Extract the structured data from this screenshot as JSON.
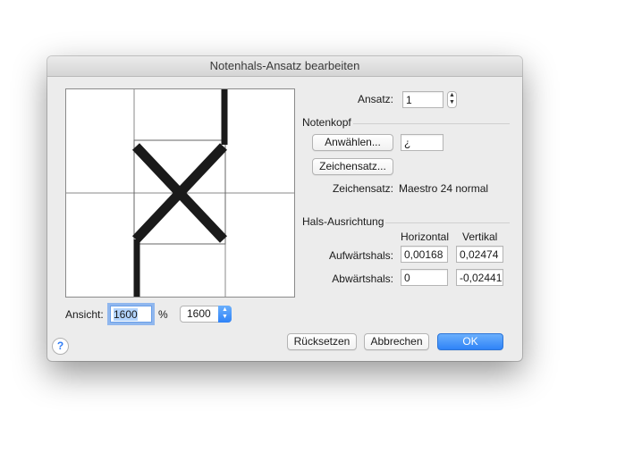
{
  "window": {
    "title": "Notenhals-Ansatz bearbeiten"
  },
  "ansatz": {
    "label": "Ansatz:",
    "value": "1"
  },
  "notenkopf": {
    "section_title": "Notenkopf",
    "select_button": "Anwählen...",
    "symbol_value": "¿",
    "font_button": "Zeichensatz...",
    "font_label": "Zeichensatz:",
    "font_value": "Maestro 24 normal"
  },
  "hals": {
    "section_title": "Hals-Ausrichtung",
    "col_horizontal": "Horizontal",
    "col_vertical": "Vertikal",
    "up_label": "Aufwärtshals:",
    "up_horizontal": "0,00168",
    "up_vertical": "0,02474",
    "down_label": "Abwärtshals:",
    "down_horizontal": "0",
    "down_vertical": "-0,02441"
  },
  "view": {
    "label": "Ansicht:",
    "value": "1600",
    "unit": "%",
    "popup_value": "1600"
  },
  "buttons": {
    "reset": "Rücksetzen",
    "cancel": "Abbrechen",
    "ok": "OK"
  },
  "icons": {
    "help": "help-icon",
    "stepper": "stepper-icon",
    "popup_arrows": "chevron-updown-icon"
  },
  "colors": {
    "accent": "#2f83f7",
    "dialog_bg": "#ececec",
    "notehead": "#1a1a1a"
  }
}
